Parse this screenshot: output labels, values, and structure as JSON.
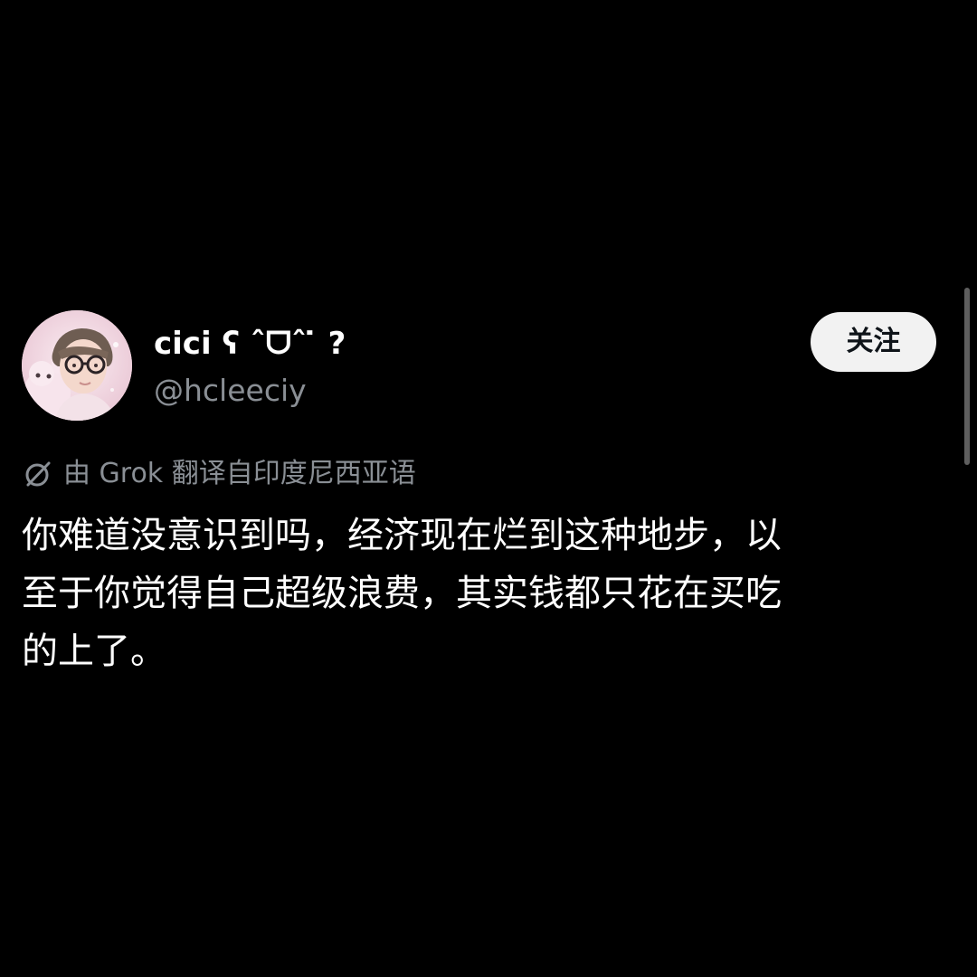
{
  "post": {
    "author": {
      "display_name": "cici ʕ ˆᗜˆ ̇ ? ",
      "handle": "@hcleeciy",
      "avatar_icon": "avatar-photo"
    },
    "follow_button_label": "关注",
    "translation_notice": "由 Grok 翻译自印度尼西亚语",
    "translation_icon": "grok-icon",
    "text_lines": [
      "你难道没意识到吗，经济现在烂到这种地步，以",
      "至于你觉得自己超级浪费，其实钱都只花在买吃",
      "的上了。"
    ]
  },
  "colors": {
    "background": "#000000",
    "primary_text": "#ffffff",
    "secondary_text": "#8a8f95",
    "follow_button_bg": "#f2f2f2"
  }
}
